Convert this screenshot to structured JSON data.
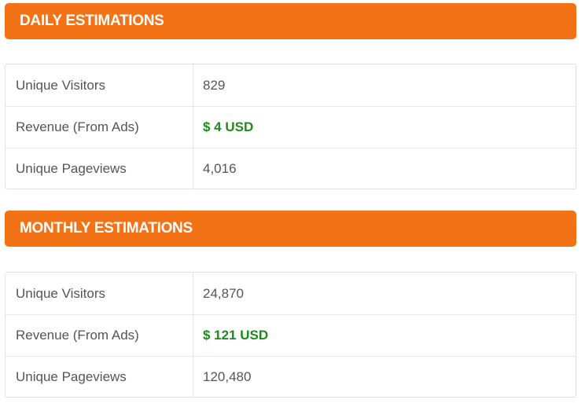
{
  "daily": {
    "title": "DAILY ESTIMATIONS",
    "rows": [
      {
        "label": "Unique Visitors",
        "value": "829"
      },
      {
        "label": "Revenue (From Ads)",
        "value": "$ 4 USD"
      },
      {
        "label": "Unique Pageviews",
        "value": "4,016"
      }
    ]
  },
  "monthly": {
    "title": "MONTHLY ESTIMATIONS",
    "rows": [
      {
        "label": "Unique Visitors",
        "value": "24,870"
      },
      {
        "label": "Revenue (From Ads)",
        "value": "$ 121 USD"
      },
      {
        "label": "Unique Pageviews",
        "value": "120,480"
      }
    ]
  },
  "colors": {
    "header_bg": "#f47216",
    "header_text": "#ffffff",
    "revenue_text": "#1e8a1e",
    "body_text": "#555555",
    "border": "#e1e1e1"
  }
}
